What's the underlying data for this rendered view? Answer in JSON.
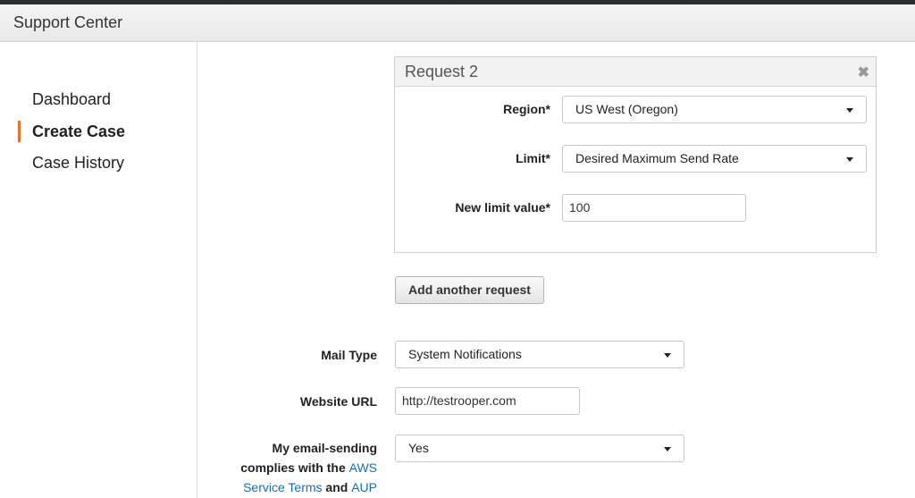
{
  "header": {
    "title": "Support Center"
  },
  "sidebar": {
    "items": [
      {
        "label": "Dashboard"
      },
      {
        "label": "Create Case"
      },
      {
        "label": "Case History"
      }
    ]
  },
  "request": {
    "title": "Request 2",
    "close_glyph": "✖",
    "region": {
      "label": "Region*",
      "value": "US West (Oregon)"
    },
    "limit": {
      "label": "Limit*",
      "value": "Desired Maximum Send Rate"
    },
    "new_limit": {
      "label": "New limit value*",
      "value": "100"
    }
  },
  "add_request_label": "Add another request",
  "mail_type": {
    "label": "Mail Type",
    "value": "System Notifications"
  },
  "website": {
    "label": "Website URL",
    "value": "http://testrooper.com"
  },
  "compliance": {
    "text_before": "My email-sending complies with the ",
    "aws_link": "AWS Service Terms",
    "text_and": " and ",
    "aup_link": "AUP",
    "value": "Yes"
  },
  "colors": {
    "accent": "#e8702a",
    "link": "#1a6db5"
  }
}
